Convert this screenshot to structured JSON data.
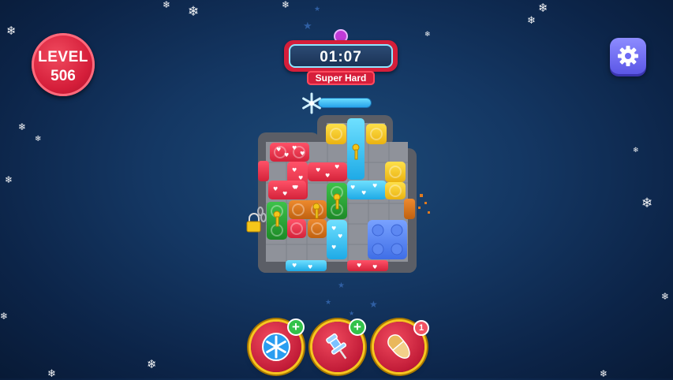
{
  "hud": {
    "level_label": "LEVEL",
    "level_number": "506",
    "timer": "01:07",
    "difficulty": "Super Hard",
    "freeze_meter_fraction": 1.0
  },
  "icons": {
    "settings": "gear-icon",
    "difficulty_badge": "skull-icon",
    "freeze_meter": "snowflake-icon",
    "lock": "padlock-icon",
    "key": "key-icon"
  },
  "powerups": [
    {
      "name": "freeze",
      "icon": "snowflake-icon",
      "badge_type": "plus",
      "badge": "+"
    },
    {
      "name": "pin",
      "icon": "pushpin-icon",
      "badge_type": "plus",
      "badge": "+"
    },
    {
      "name": "vacuum",
      "icon": "slipper-icon",
      "badge_type": "count",
      "badge": "1"
    }
  ],
  "colors": {
    "red_block": "#e8324a",
    "cyan_block": "#2ec3f0",
    "yellow_block": "#f5c61a",
    "green_block": "#27a02f",
    "orange_block": "#d9731a",
    "blue_block": "#4e7ff0",
    "wall": "#595c63",
    "floor": "#8c8f96",
    "level_badge": "#d51e3a",
    "settings_button": "#6d6af5"
  }
}
